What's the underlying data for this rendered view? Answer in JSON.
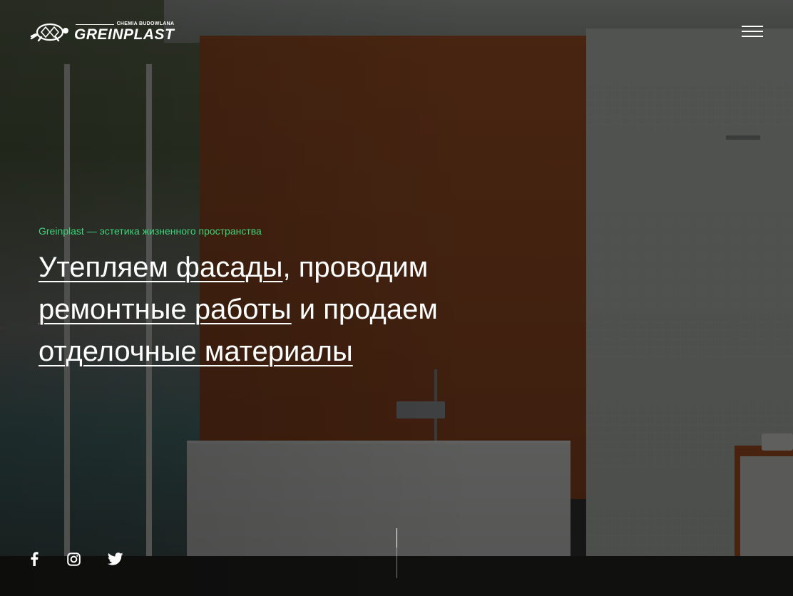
{
  "header": {
    "logo": {
      "subtitle": "CHEMIA BUDOWLANA",
      "brand": "GREINPLAST"
    },
    "menu_icon": "hamburger-menu-icon"
  },
  "hero": {
    "tagline": "Greinplast — эстетика жизненного пространства",
    "headline": {
      "link1": "Утепляем фасады",
      "text1": ", проводим",
      "link2": "ремонтные работы",
      "text2": " и продаем",
      "link3": "отделочные материалы"
    },
    "accent_color": "#3fd27a"
  },
  "social": [
    {
      "icon": "facebook-icon"
    },
    {
      "icon": "instagram-icon"
    },
    {
      "icon": "twitter-icon"
    }
  ]
}
